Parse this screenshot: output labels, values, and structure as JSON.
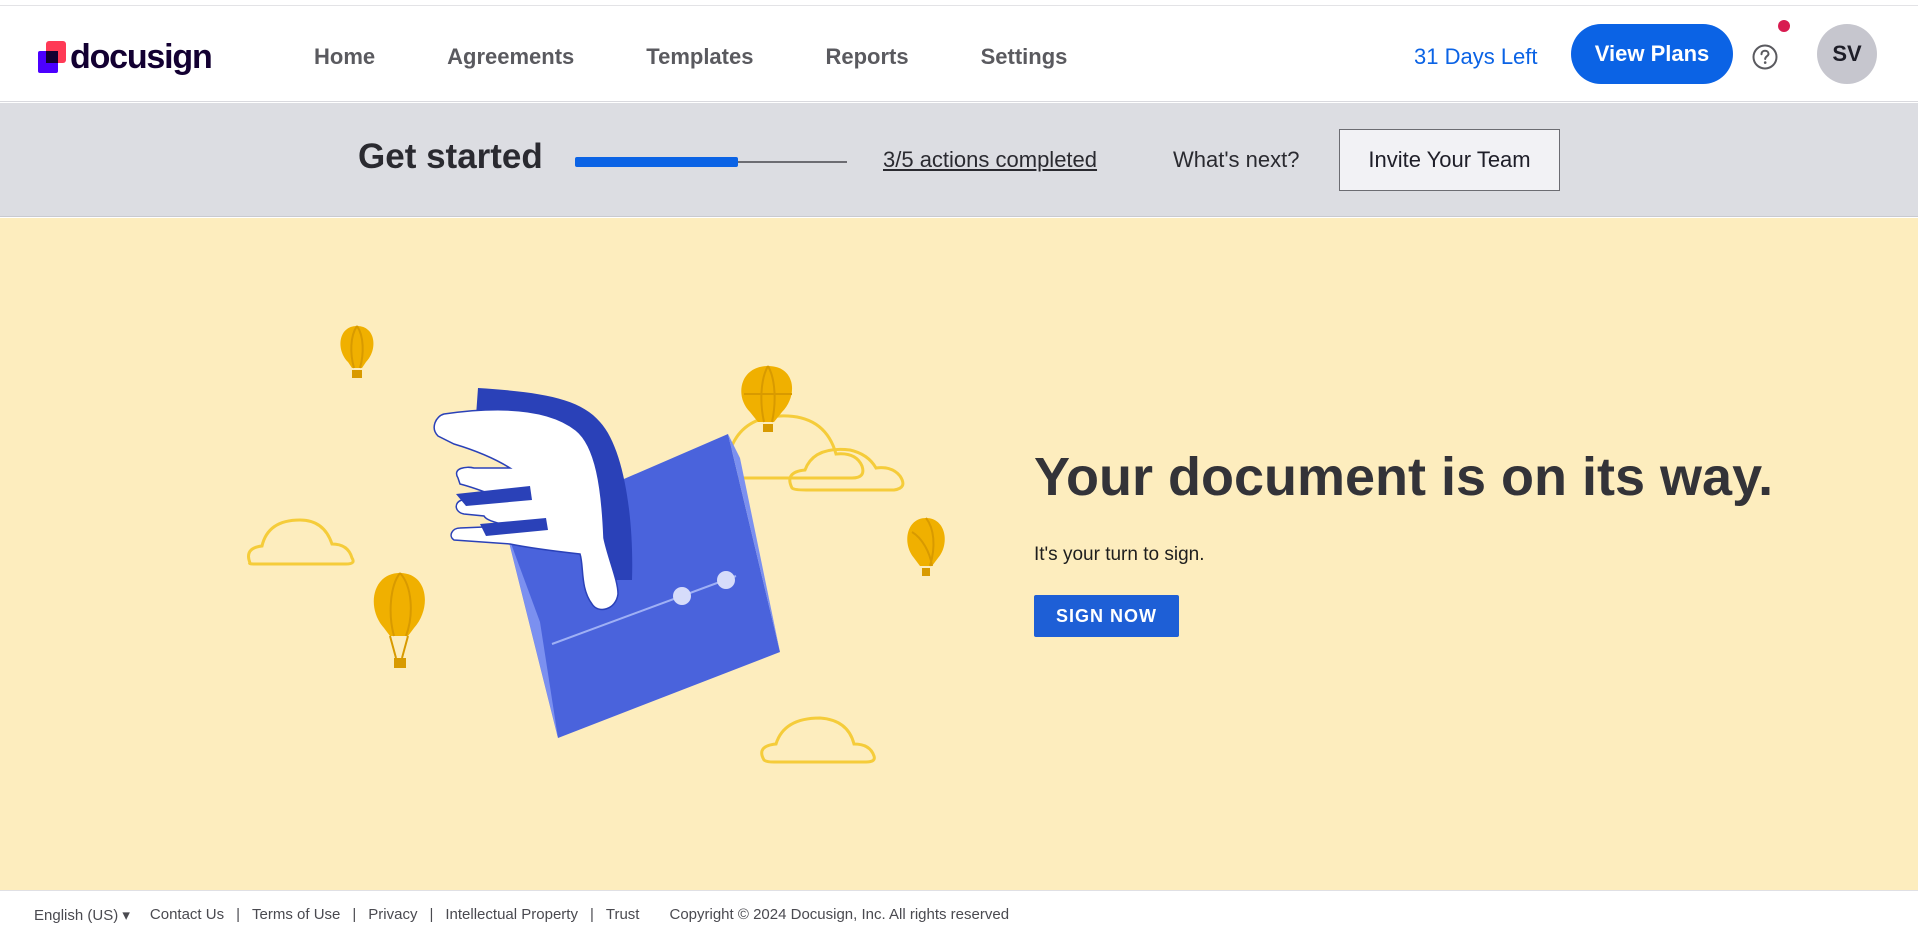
{
  "brand": {
    "name": "docusign"
  },
  "nav": {
    "items": [
      {
        "label": "Home"
      },
      {
        "label": "Agreements"
      },
      {
        "label": "Templates"
      },
      {
        "label": "Reports"
      },
      {
        "label": "Settings"
      }
    ]
  },
  "header": {
    "trial_label": "31 Days Left",
    "plans_label": "View Plans",
    "avatar_initials": "SV",
    "has_notification": true
  },
  "get_started": {
    "title": "Get started",
    "progress_fraction": 0.6,
    "actions_label": "3/5 actions completed",
    "next_label": "What's next?",
    "invite_label": "Invite Your Team"
  },
  "hero": {
    "title": "Your document is on its way.",
    "subtitle": "It's your turn to sign.",
    "cta_label": "SIGN NOW"
  },
  "footer": {
    "language": "English (US)",
    "links": [
      "Contact Us",
      "Terms of Use",
      "Privacy",
      "Intellectual Property",
      "Trust"
    ],
    "copyright": "Copyright © 2024 Docusign, Inc. All rights reserved"
  },
  "colors": {
    "accent": "#0b63e5",
    "hero_bg": "#fdedbe",
    "banner_bg": "#dcdde2",
    "notification": "#d81b50",
    "balloon": "#f0b000",
    "envelope": "#4a63dc"
  }
}
